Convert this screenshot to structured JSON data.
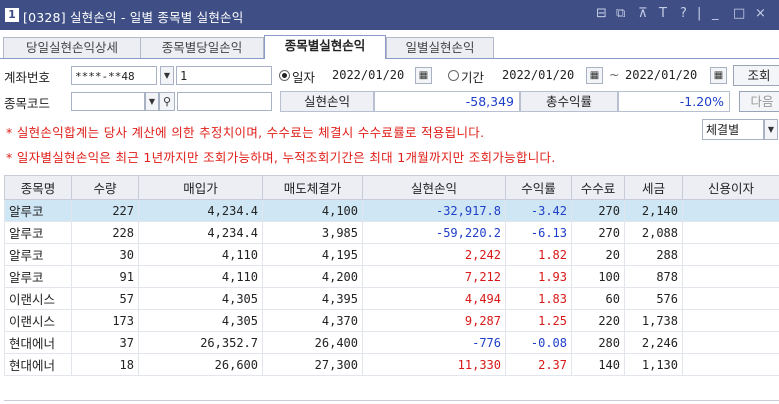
{
  "window": {
    "number": "1",
    "title": "[0328] 실현손익 - 일별 종목별 실현손익",
    "controls": [
      "⊟",
      "⧉",
      "⊼",
      "T",
      "?",
      "|",
      "_",
      "□",
      "×"
    ]
  },
  "tabs": [
    {
      "label": "당일실현손익상세",
      "active": false
    },
    {
      "label": "종목별당일손익",
      "active": false
    },
    {
      "label": "종목별실현손익",
      "active": true
    },
    {
      "label": "일별실현손익",
      "active": false
    }
  ],
  "account": {
    "label": "계좌번호",
    "number": "****-**48",
    "sub": "1"
  },
  "period": {
    "date_label": "일자",
    "date_value": "2022/01/20",
    "range_label": "기간",
    "range_from": "2022/01/20",
    "range_sep": "~",
    "range_to": "2022/01/20",
    "mode": "date"
  },
  "buttons": {
    "inquiry": "조회",
    "next": "다음"
  },
  "stock": {
    "label": "종목코드",
    "code": "",
    "name": ""
  },
  "summary": {
    "pnl_label": "실현손익",
    "pnl_value": "-58,349",
    "return_label": "총수익률",
    "return_value": "-1.20%"
  },
  "notices": [
    "* 실현손익합계는 당사 계산에 의한 추정치이며, 수수료는 체결시 수수료률로 적용됩니다.",
    "* 일자별실현손익은 최근 1년까지만 조회가능하며, 누적조회기간은 최대 1개월까지만 조회가능합니다."
  ],
  "filter": {
    "selected": "체결별"
  },
  "table": {
    "columns": [
      "종목명",
      "수량",
      "매입가",
      "매도체결가",
      "실현손익",
      "수익률",
      "수수료",
      "세금",
      "신용이자"
    ],
    "rows": [
      {
        "name": "알루코",
        "qty": "227",
        "buy": "4,234.4",
        "sell": "4,100",
        "pnl": "-32,917.8",
        "rate": "-3.42",
        "fee": "270",
        "tax": "2,140",
        "credit": "",
        "sign": "neg"
      },
      {
        "name": "알루코",
        "qty": "228",
        "buy": "4,234.4",
        "sell": "3,985",
        "pnl": "-59,220.2",
        "rate": "-6.13",
        "fee": "270",
        "tax": "2,088",
        "credit": "",
        "sign": "neg"
      },
      {
        "name": "알루코",
        "qty": "30",
        "buy": "4,110",
        "sell": "4,195",
        "pnl": "2,242",
        "rate": "1.82",
        "fee": "20",
        "tax": "288",
        "credit": "",
        "sign": "pos"
      },
      {
        "name": "알루코",
        "qty": "91",
        "buy": "4,110",
        "sell": "4,200",
        "pnl": "7,212",
        "rate": "1.93",
        "fee": "100",
        "tax": "878",
        "credit": "",
        "sign": "pos"
      },
      {
        "name": "이랜시스",
        "qty": "57",
        "buy": "4,305",
        "sell": "4,395",
        "pnl": "4,494",
        "rate": "1.83",
        "fee": "60",
        "tax": "576",
        "credit": "",
        "sign": "pos"
      },
      {
        "name": "이랜시스",
        "qty": "173",
        "buy": "4,305",
        "sell": "4,370",
        "pnl": "9,287",
        "rate": "1.25",
        "fee": "220",
        "tax": "1,738",
        "credit": "",
        "sign": "pos"
      },
      {
        "name": "현대에너",
        "qty": "37",
        "buy": "26,352.7",
        "sell": "26,400",
        "pnl": "-776",
        "rate": "-0.08",
        "fee": "280",
        "tax": "2,246",
        "credit": "",
        "sign": "neg"
      },
      {
        "name": "현대에너",
        "qty": "18",
        "buy": "26,600",
        "sell": "27,300",
        "pnl": "11,330",
        "rate": "2.37",
        "fee": "140",
        "tax": "1,130",
        "credit": "",
        "sign": "pos"
      }
    ]
  },
  "colors": {
    "titlebar": "#3f4f86",
    "negative": "#1e3fc8",
    "positive": "#d81818",
    "notice": "#e0201a",
    "selected_row": "#cfe6f5"
  }
}
